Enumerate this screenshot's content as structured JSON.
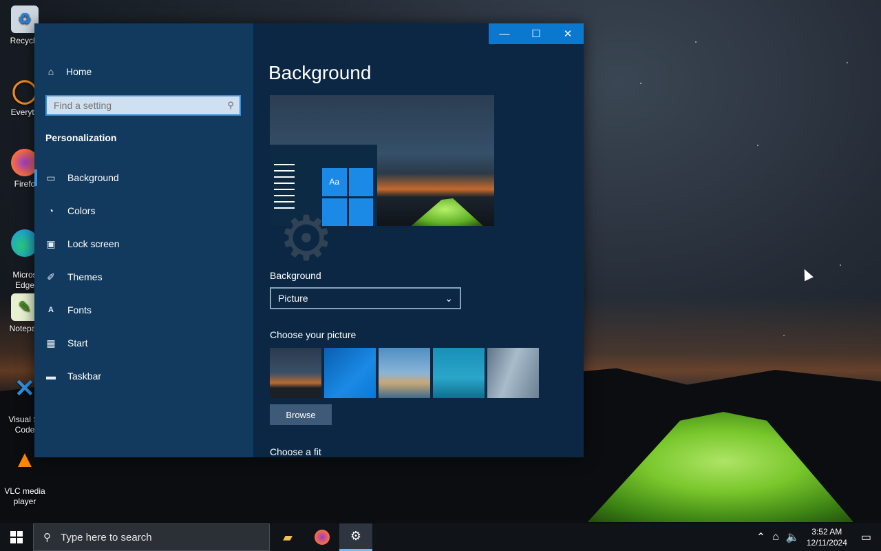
{
  "desktop": {
    "icons": [
      {
        "label": "Recycle",
        "icon": "recycle-bin-icon",
        "color": "#cfd8e0"
      },
      {
        "label": "Everyth",
        "icon": "everything-icon",
        "color": "#f08a1c"
      },
      {
        "label": "Firefo",
        "icon": "firefox-icon",
        "color": "#ff7139"
      },
      {
        "label": "Micros\nEdge",
        "icon": "edge-icon",
        "color": "#1ea1d6"
      },
      {
        "label": "Notepac",
        "icon": "notepad-icon",
        "color": "#8bc34a"
      },
      {
        "label": "Visual St\nCode",
        "icon": "vscode-icon",
        "color": "#2f8fe0"
      },
      {
        "label": "VLC media\nplayer",
        "icon": "vlc-icon",
        "color": "#ff8800"
      }
    ]
  },
  "window": {
    "controls": {
      "minimize": "—",
      "maximize": "☐",
      "close": "✕"
    },
    "sidebar": {
      "home": "Home",
      "search_placeholder": "Find a setting",
      "section": "Personalization",
      "items": [
        {
          "label": "Background",
          "icon": "picture-icon",
          "active": true
        },
        {
          "label": "Colors",
          "icon": "palette-icon"
        },
        {
          "label": "Lock screen",
          "icon": "lock-screen-icon"
        },
        {
          "label": "Themes",
          "icon": "brush-icon"
        },
        {
          "label": "Fonts",
          "icon": "font-icon"
        },
        {
          "label": "Start",
          "icon": "start-icon"
        },
        {
          "label": "Taskbar",
          "icon": "taskbar-icon"
        }
      ]
    },
    "content": {
      "title": "Background",
      "preview_tile": "Aa",
      "background_label": "Background",
      "background_value": "Picture",
      "choose_picture": "Choose your picture",
      "browse": "Browse",
      "choose_fit": "Choose a fit",
      "thumb_colors": [
        "#2b3a4e",
        "#0a78d7",
        "#6f9fc4",
        "#2aa6c9",
        "#9fb3c4"
      ]
    }
  },
  "taskbar": {
    "search_placeholder": "Type here to search",
    "time": "3:52 AM",
    "date": "12/11/2024"
  }
}
